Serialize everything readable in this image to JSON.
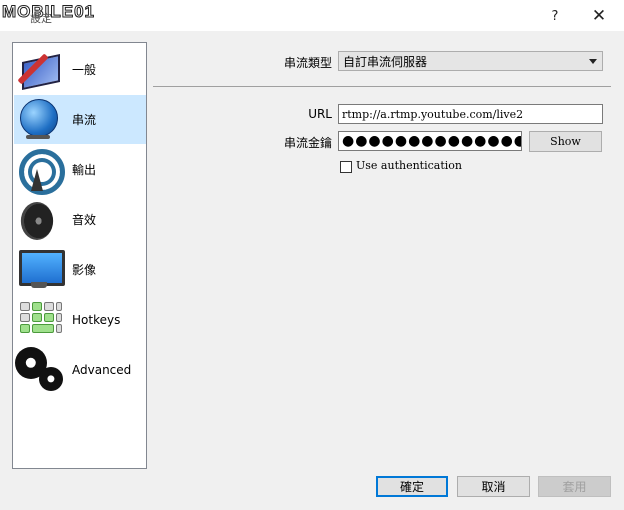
{
  "window": {
    "title": "設定",
    "logo_text": "MOBILE01",
    "help_label": "?",
    "close_label": "✕"
  },
  "sidebar": {
    "items": [
      {
        "label": "一般",
        "icon": "monitor-pen-icon"
      },
      {
        "label": "串流",
        "icon": "globe-network-icon"
      },
      {
        "label": "輸出",
        "icon": "broadcast-antenna-icon"
      },
      {
        "label": "音效",
        "icon": "speaker-icon"
      },
      {
        "label": "影像",
        "icon": "display-monitor-icon"
      },
      {
        "label": "Hotkeys",
        "icon": "keyboard-icon"
      },
      {
        "label": "Advanced",
        "icon": "gears-icon"
      }
    ],
    "selected_index": 1
  },
  "stream": {
    "type_label": "串流類型",
    "type_value": "自訂串流伺服器",
    "url_label": "URL",
    "url_value": "rtmp://a.rtmp.youtube.com/live2",
    "key_label": "串流金鑰",
    "key_value": "●●●●●●●●●●●●●●●●●●●●",
    "show_label": "Show",
    "use_auth_label": "Use authentication",
    "use_auth_checked": false
  },
  "footer": {
    "ok_label": "確定",
    "cancel_label": "取消",
    "apply_label": "套用"
  }
}
